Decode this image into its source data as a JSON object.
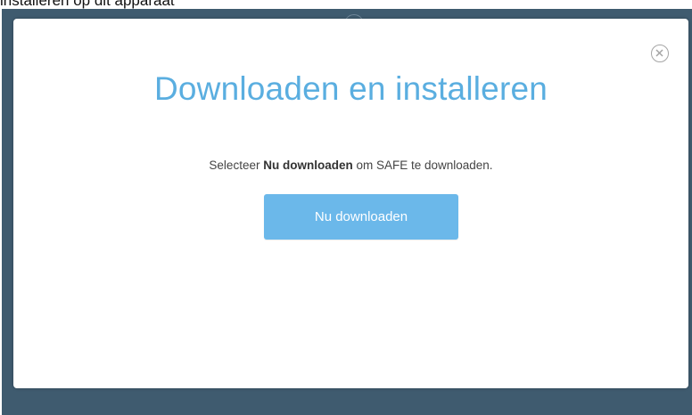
{
  "page": {
    "background_text": "installeren op dit apparaat"
  },
  "modal": {
    "title": "Downloaden en installeren",
    "instruction_prefix": "Selecteer ",
    "instruction_bold": "Nu downloaden",
    "instruction_suffix": " om SAFE te downloaden.",
    "download_button_label": "Nu downloaden",
    "close_icon": "close-circle-icon"
  },
  "colors": {
    "title": "#5aaee0",
    "button": "#6bb8ea",
    "backdrop": "#3f5b6f"
  }
}
